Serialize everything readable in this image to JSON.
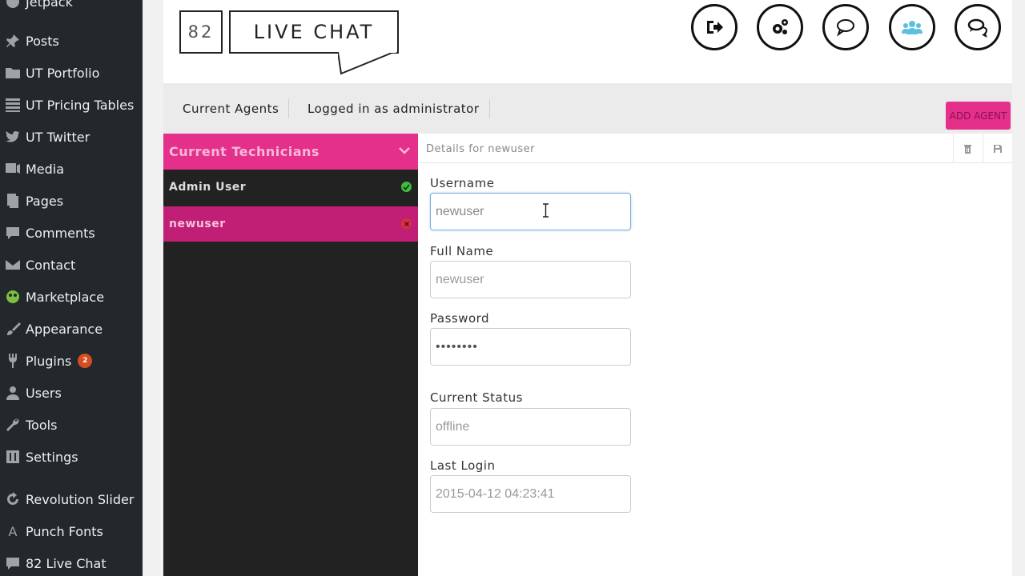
{
  "wp_sidebar": {
    "items": [
      {
        "label": "Jetpack",
        "icon": "jetpack-icon"
      },
      {
        "label": "Posts",
        "icon": "pin-icon"
      },
      {
        "label": "UT Portfolio",
        "icon": "folder-icon"
      },
      {
        "label": "UT Pricing Tables",
        "icon": "list-icon"
      },
      {
        "label": "UT Twitter",
        "icon": "twitter-icon"
      },
      {
        "label": "Media",
        "icon": "media-icon"
      },
      {
        "label": "Pages",
        "icon": "pages-icon"
      },
      {
        "label": "Comments",
        "icon": "comment-icon"
      },
      {
        "label": "Contact",
        "icon": "mail-icon"
      },
      {
        "label": "Marketplace",
        "icon": "marketplace-icon"
      },
      {
        "label": "Appearance",
        "icon": "brush-icon"
      },
      {
        "label": "Plugins",
        "icon": "plugin-icon",
        "badge": "2"
      },
      {
        "label": "Users",
        "icon": "user-icon"
      },
      {
        "label": "Tools",
        "icon": "wrench-icon"
      },
      {
        "label": "Settings",
        "icon": "settings-icon"
      },
      {
        "label": "Revolution Slider",
        "icon": "refresh-icon"
      },
      {
        "label": "Punch Fonts",
        "icon": "font-icon"
      },
      {
        "label": "82 Live Chat",
        "icon": "chat-icon"
      }
    ]
  },
  "header": {
    "logo_number": "82",
    "logo_text": "LIVE CHAT",
    "icons": [
      "logout-icon",
      "settings-gears-icon",
      "chat-bubble-icon",
      "agents-icon",
      "conversations-icon"
    ]
  },
  "subnav": {
    "current_agents": "Current Agents",
    "logged_in": "Logged in as administrator",
    "add_agent": "ADD AGENT"
  },
  "technicians": {
    "header": "Current Technicians",
    "rows": [
      {
        "name": "Admin User",
        "status": "online"
      },
      {
        "name": "newuser",
        "status": "offline"
      }
    ]
  },
  "details": {
    "title": "Details for newuser",
    "username_label": "Username",
    "username_value": "newuser",
    "fullname_label": "Full Name",
    "fullname_value": "newuser",
    "password_label": "Password",
    "password_value": "••••••••",
    "status_label": "Current Status",
    "status_value": "offline",
    "lastlogin_label": "Last Login",
    "lastlogin_value": "2015-04-12 04:23:41"
  },
  "colors": {
    "accent": "#e5308b",
    "selected_row": "#c01f75",
    "wp_sidebar": "#23282d",
    "online": "#3cbf3c",
    "offline": "#e02d3c"
  }
}
